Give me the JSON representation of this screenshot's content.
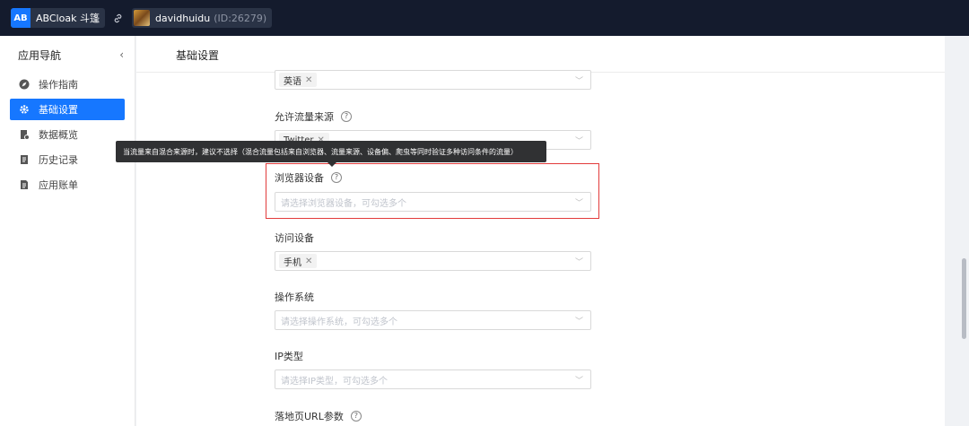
{
  "topbar": {
    "app_logo": "AB",
    "app_name": "ABCloak 斗篷",
    "link_icon": "link-icon",
    "user_name": "davidhuidu",
    "user_id": "(ID:26279)"
  },
  "sidebar": {
    "title": "应用导航",
    "collapse": "‹",
    "items": [
      {
        "label": "操作指南",
        "icon": "navigation-icon",
        "active": false
      },
      {
        "label": "基础设置",
        "icon": "gear-icon",
        "active": true
      },
      {
        "label": "数据概览",
        "icon": "data-doc-icon",
        "active": false
      },
      {
        "label": "历史记录",
        "icon": "history-icon",
        "active": false
      },
      {
        "label": "应用账单",
        "icon": "bill-icon",
        "active": false
      }
    ]
  },
  "content": {
    "title": "基础设置",
    "language_tag": "英语",
    "traffic_source": {
      "label": "允许流量来源",
      "tag": "Twitter"
    },
    "tooltip": "当流量来自混合来源时，建议不选择（混合流量包括来自浏览器、流量来源、设备偏、爬虫等同时验证多种访问条件的流量）",
    "browser": {
      "label": "浏览器设备",
      "placeholder": "请选择浏览器设备，可勾选多个"
    },
    "device": {
      "label": "访问设备",
      "tag": "手机"
    },
    "os": {
      "label": "操作系统",
      "placeholder": "请选择操作系统，可勾选多个"
    },
    "ip": {
      "label": "IP类型",
      "placeholder": "请选择IP类型，可勾选多个"
    },
    "landing": {
      "label": "落地页URL参数"
    }
  },
  "colors": {
    "topbar_bg": "#141b2d",
    "accent": "#1677ff",
    "highlight": "#e23b3b"
  }
}
